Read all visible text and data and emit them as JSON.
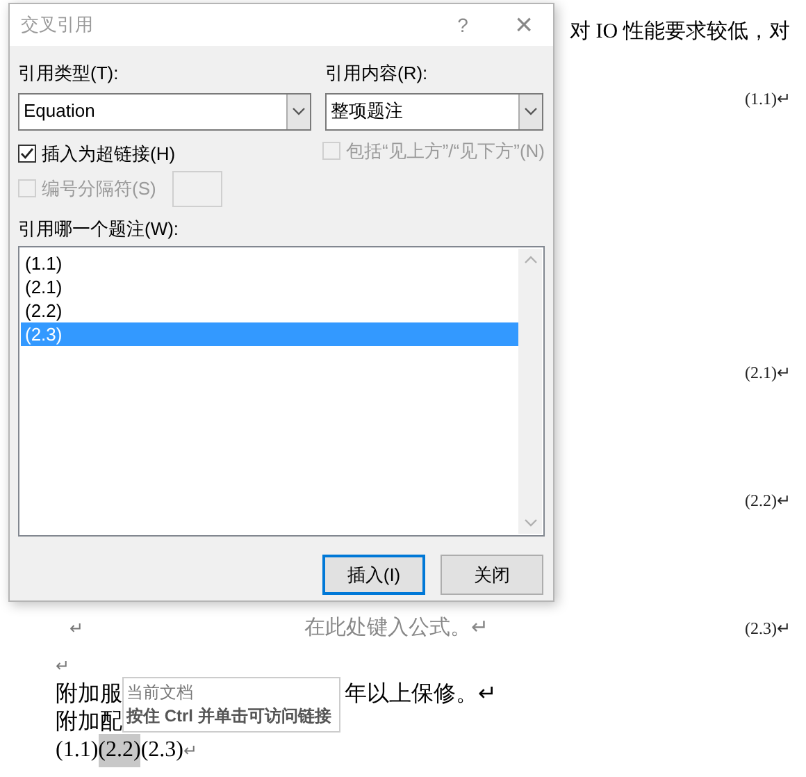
{
  "document": {
    "blocks": [
      {
        "kind": "text_right",
        "text": "对 IO 性能要求较低，对"
      },
      {
        "kind": "equation",
        "number": "(1.1)↵"
      },
      {
        "kind": "equation",
        "number": "(2.1)↵"
      },
      {
        "kind": "equation",
        "number": "(2.2)↵"
      },
      {
        "kind": "equation",
        "lead": "↵",
        "prompt": "在此处键入公式。↵",
        "number": "(2.3)↵"
      },
      {
        "kind": "empty",
        "text": "↵"
      },
      {
        "kind": "paragraph",
        "parts": [
          "附加服",
          "年以上保修。↵"
        ]
      },
      {
        "kind": "paragraph",
        "parts": [
          "附加配"
        ]
      },
      {
        "kind": "refs",
        "refs": [
          {
            "text": "(1.1)",
            "highlighted": false
          },
          {
            "text": "(2.2)",
            "highlighted": true
          },
          {
            "text": "(2.3)",
            "highlighted": false
          }
        ],
        "mark": "↵"
      }
    ]
  },
  "tooltip": {
    "title": "当前文档",
    "hint": "按住 Ctrl 并单击可访问链接"
  },
  "dialog": {
    "title": "交叉引用",
    "help": "?",
    "close": "×",
    "type_label": "引用类型(T):",
    "type_value": "Equation",
    "content_label": "引用内容(R):",
    "content_value": "整项题注",
    "insert_hyperlink": {
      "label": "插入为超链接(H)",
      "checked": true,
      "disabled": false
    },
    "include_above_below": {
      "label": "包括“见上方”/“见下方”(N)",
      "checked": false,
      "disabled": true
    },
    "separator": {
      "label": "编号分隔符(S)",
      "checked": false,
      "disabled": true
    },
    "list_label": "引用哪一个题注(W):",
    "items": [
      {
        "text": "(1.1)",
        "selected": false
      },
      {
        "text": "(2.1)",
        "selected": false
      },
      {
        "text": "(2.2)",
        "selected": false
      },
      {
        "text": "(2.3)",
        "selected": true
      }
    ],
    "buttons": [
      {
        "label": "插入(I)",
        "default": true
      },
      {
        "label": "关闭",
        "default": false
      }
    ]
  }
}
